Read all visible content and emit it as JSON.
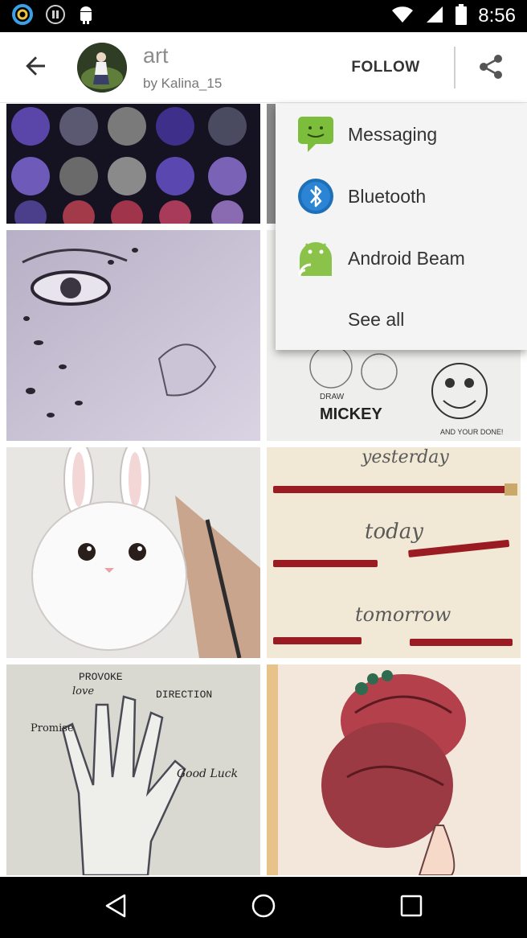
{
  "status_bar": {
    "time": "8:56",
    "icons": [
      "circle-app-icon",
      "pause-icon",
      "android-icon",
      "wifi-icon",
      "signal-icon",
      "battery-icon"
    ]
  },
  "header": {
    "board_title": "art",
    "board_author": "by Kalina_15",
    "follow_label": "FOLLOW",
    "icons": [
      "back-arrow-icon",
      "avatar",
      "share-icon"
    ]
  },
  "share_menu": {
    "items": [
      {
        "label": "Messaging",
        "icon": "messaging-icon"
      },
      {
        "label": "Bluetooth",
        "icon": "bluetooth-icon"
      },
      {
        "label": "Android Beam",
        "icon": "android-beam-icon"
      },
      {
        "label": "See all"
      }
    ]
  },
  "grid": {
    "images": [
      {
        "name": "moon-phases-image",
        "caption": ""
      },
      {
        "name": "hidden-image",
        "caption": ""
      },
      {
        "name": "leopard-eye-sketch-image",
        "caption": ""
      },
      {
        "name": "mickey-sketch-image",
        "text": "MICKEY",
        "signature": "AND YOUR DONE!",
        "header": "DRAW"
      },
      {
        "name": "bunny-drawing-image",
        "caption": ""
      },
      {
        "name": "pencils-image",
        "words": [
          "yesterday",
          "today",
          "tomorrow"
        ]
      },
      {
        "name": "hand-sketch-image",
        "words": [
          "PROVOKE",
          "love",
          "DIRECTION",
          "Promise",
          "Good Luck"
        ]
      },
      {
        "name": "girl-hair-drawing-image",
        "caption": ""
      }
    ]
  },
  "nav_bar": {
    "icons": [
      "back-triangle-icon",
      "home-circle-icon",
      "recents-square-icon"
    ]
  },
  "colors": {
    "status_bar": "#000000",
    "nav_bar": "#000000",
    "messaging_green": "#7cbd3b",
    "bluetooth_blue": "#1d6fb8",
    "android_green": "#8bc34a",
    "menu_bg": "#f4f4f4"
  }
}
